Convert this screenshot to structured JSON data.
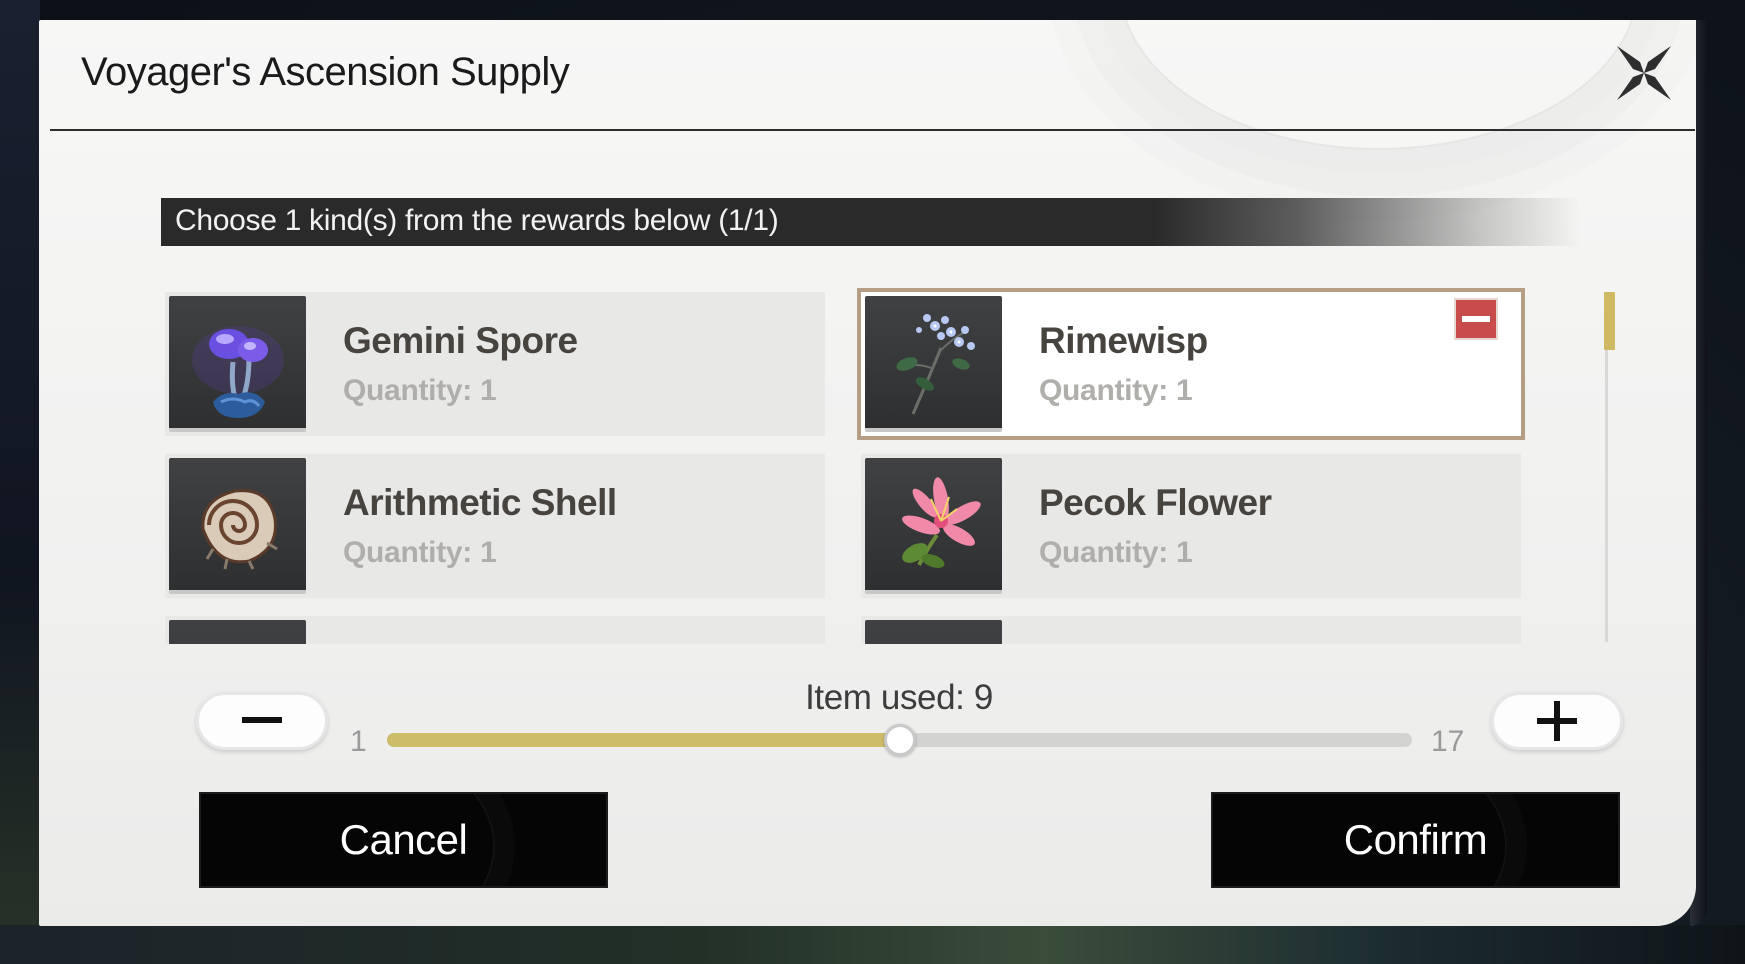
{
  "dialog": {
    "title": "Voyager's Ascension Supply",
    "banner": "Choose 1 kind(s) from the rewards below (1/1)"
  },
  "rewards": [
    {
      "name": "Gemini Spore",
      "quantity": "Quantity: 1",
      "icon": "gemini-spore-icon",
      "selected": false
    },
    {
      "name": "Rimewisp",
      "quantity": "Quantity: 1",
      "icon": "rimewisp-icon",
      "selected": true
    },
    {
      "name": "Arithmetic Shell",
      "quantity": "Quantity: 1",
      "icon": "arithmetic-shell-icon",
      "selected": false
    },
    {
      "name": "Pecok Flower",
      "quantity": "Quantity: 1",
      "icon": "pecok-flower-icon",
      "selected": false
    }
  ],
  "quantity": {
    "label": "Item used: 9",
    "min": "1",
    "max": "17",
    "value": 9,
    "fill_fraction": 0.5
  },
  "buttons": {
    "cancel": "Cancel",
    "confirm": "Confirm"
  },
  "colors": {
    "selected_border": "#b49f84",
    "slider_fill": "#cdbd6b",
    "remove_badge": "#c94c4c",
    "scroll_thumb": "#cfb962"
  }
}
